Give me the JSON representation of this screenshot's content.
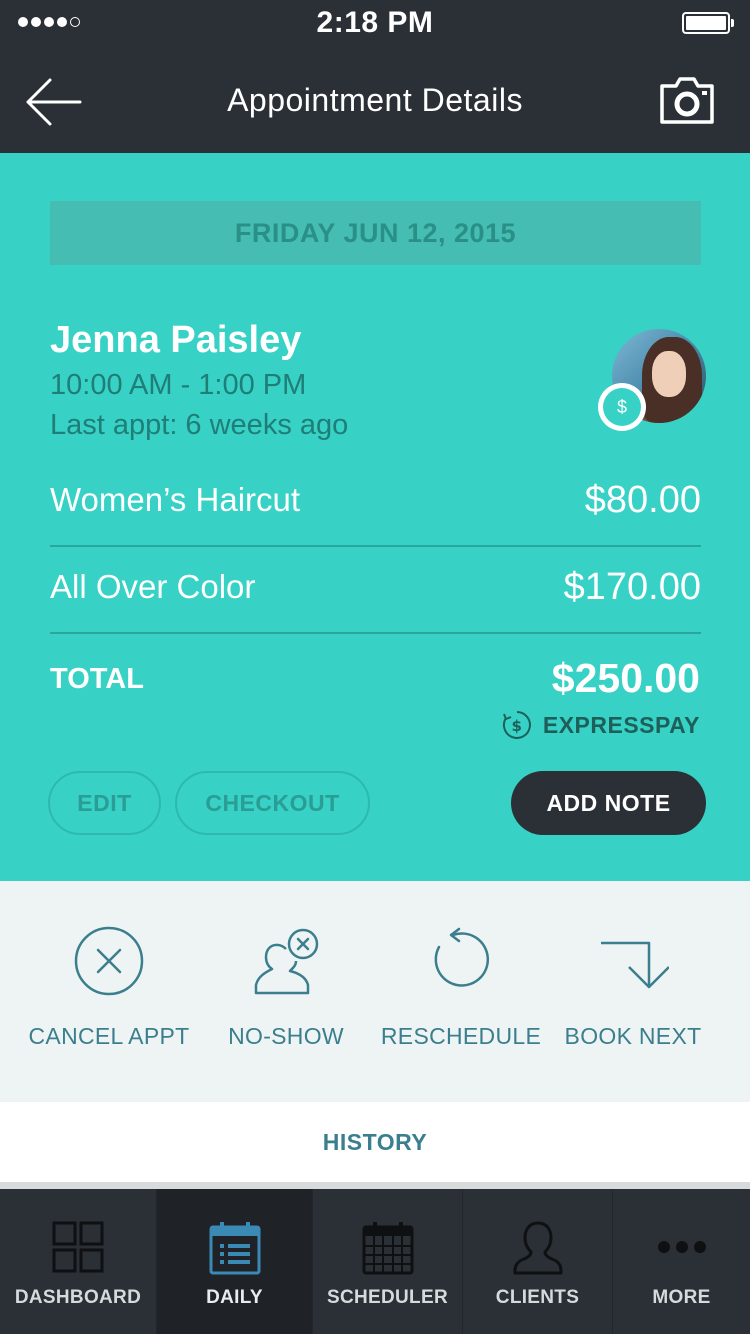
{
  "status_bar": {
    "time": "2:18 PM"
  },
  "nav": {
    "title": "Appointment Details",
    "back_icon": "arrow-left-icon",
    "camera_icon": "camera-icon"
  },
  "appointment": {
    "date": "FRIDAY JUN 12, 2015",
    "client_name": "Jenna Paisley",
    "time_range": "10:00 AM - 1:00 PM",
    "last_appt": "Last appt: 6 weeks ago",
    "services": [
      {
        "name": "Women’s Haircut",
        "price": "$80.00"
      },
      {
        "name": "All Over Color",
        "price": "$170.00"
      }
    ],
    "total_label": "TOTAL",
    "total_value": "$250.00",
    "payment_method": "EXPRESSPAY",
    "badge_glyph": "$"
  },
  "buttons": {
    "edit": "EDIT",
    "checkout": "CHECKOUT",
    "add_note": "ADD NOTE"
  },
  "actions": [
    {
      "label": "CANCEL APPT",
      "icon": "cancel-circle-icon"
    },
    {
      "label": "NO-SHOW",
      "icon": "person-x-icon"
    },
    {
      "label": "RESCHEDULE",
      "icon": "refresh-icon"
    },
    {
      "label": "BOOK NEXT",
      "icon": "arrow-down-right-icon"
    }
  ],
  "history": {
    "label": "HISTORY"
  },
  "tabs": [
    {
      "label": "DASHBOARD",
      "icon": "grid-icon",
      "active": false
    },
    {
      "label": "DAILY",
      "icon": "calendar-list-icon",
      "active": true
    },
    {
      "label": "SCHEDULER",
      "icon": "calendar-grid-icon",
      "active": false
    },
    {
      "label": "CLIENTS",
      "icon": "person-icon",
      "active": false
    },
    {
      "label": "MORE",
      "icon": "dots-icon",
      "active": false
    }
  ],
  "colors": {
    "dark": "#2b3036",
    "teal": "#37d1c5",
    "teal_dark_text": "#1f7e77",
    "action_blue": "#3b7e8e",
    "light_bg": "#eef4f4"
  }
}
